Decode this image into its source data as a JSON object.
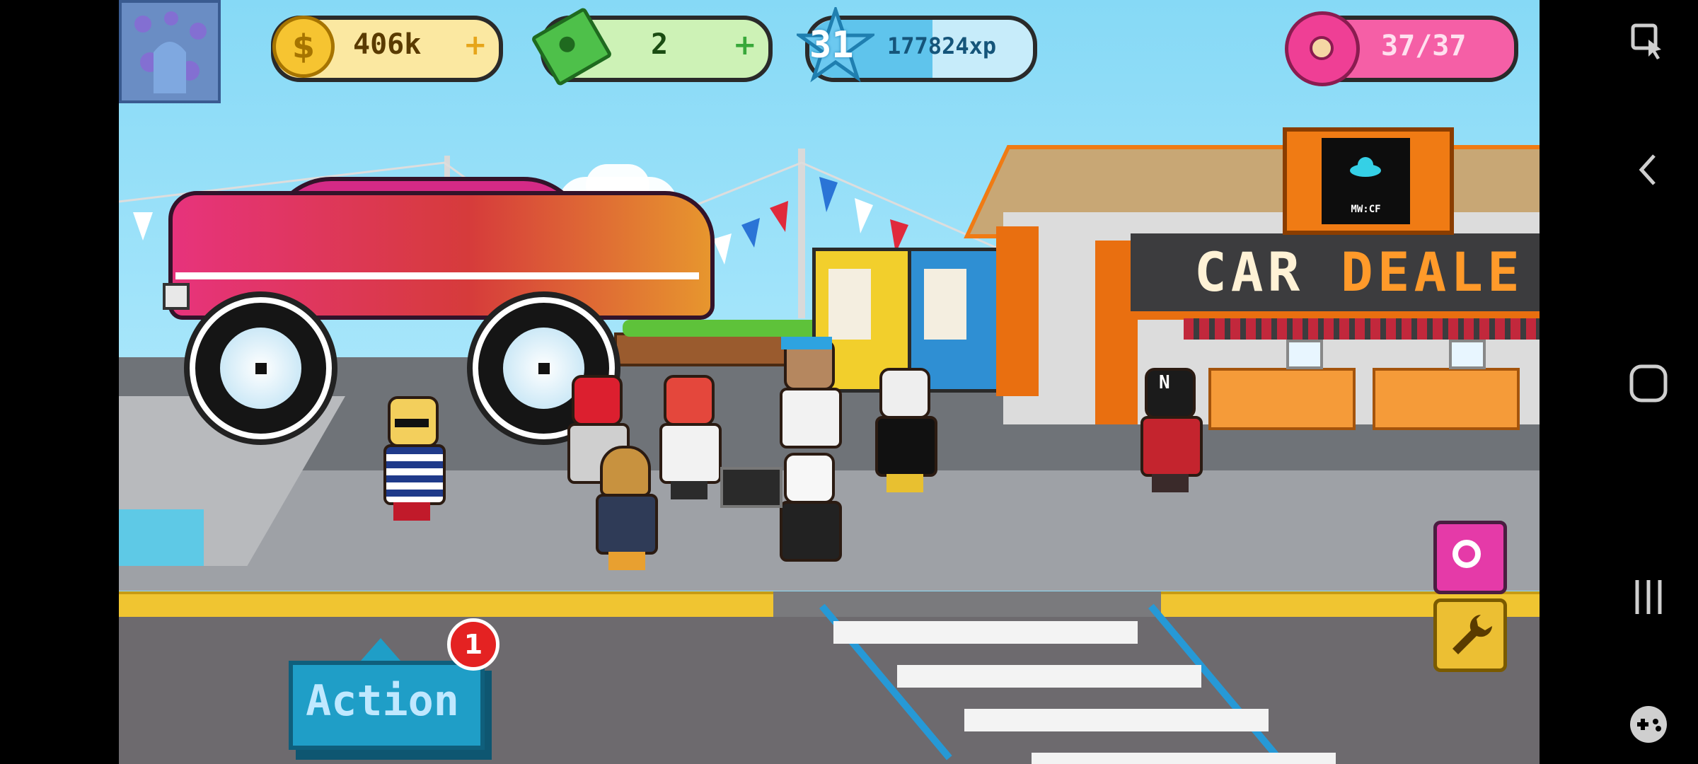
{
  "hud": {
    "coins": "406k",
    "coins_plus": "+",
    "cash": "2",
    "cash_plus": "+",
    "level": "31",
    "xp": "177824xp",
    "xp_progress": 0.55,
    "donuts": "37/37"
  },
  "scene": {
    "dealer_sign_white": "CAR ",
    "dealer_sign_orange": "DEALE",
    "screen_label": "MW:CF",
    "cap_letter": "N"
  },
  "actions": {
    "action_label": "Action",
    "action_badge": "1"
  },
  "colors": {
    "coin": "#f6c431",
    "cash": "#5ac94a",
    "xp": "#3bb5e6",
    "donut": "#ef3f95",
    "action": "#1f9ec7"
  },
  "icons": {
    "coins": "dollar-coin-icon",
    "cash": "cash-bill-icon",
    "xp": "level-star-icon",
    "donut": "donut-icon",
    "camera": "camera-lens-icon",
    "wrench": "wrench-icon"
  },
  "system_nav": {
    "items": [
      "game-tools",
      "back",
      "home",
      "recents",
      "game-launcher"
    ]
  }
}
